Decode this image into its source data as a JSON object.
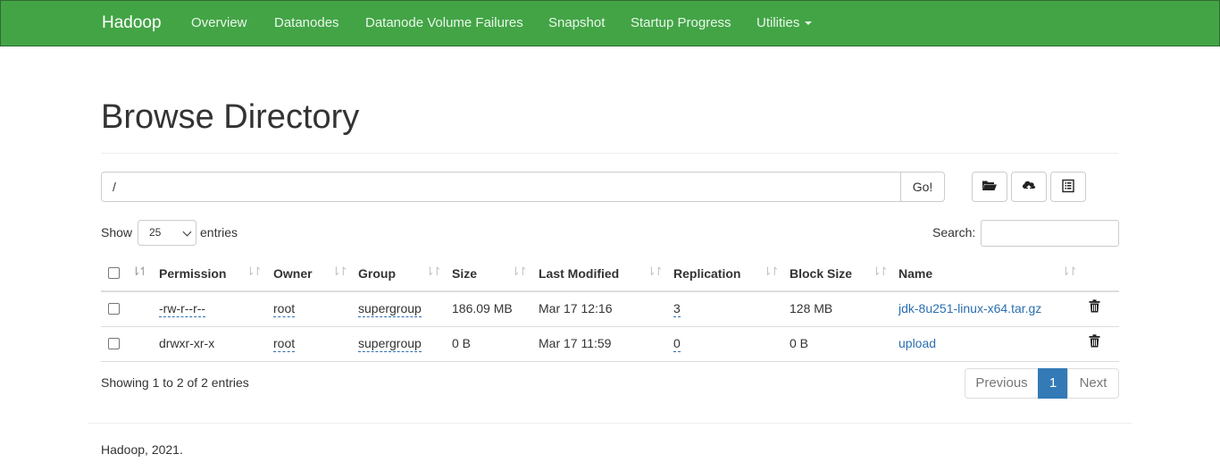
{
  "navbar": {
    "brand": "Hadoop",
    "items": [
      "Overview",
      "Datanodes",
      "Datanode Volume Failures",
      "Snapshot",
      "Startup Progress",
      "Utilities"
    ]
  },
  "page_title": "Browse Directory",
  "path_bar": {
    "value": "/",
    "go_label": "Go!",
    "icons": [
      "folder-open-icon",
      "cloud-upload-icon",
      "list-alt-icon"
    ]
  },
  "table_controls": {
    "show_label": "Show",
    "entries_value": "25",
    "entries_label": "entries",
    "search_label": "Search:"
  },
  "table": {
    "columns": [
      "Permission",
      "Owner",
      "Group",
      "Size",
      "Last Modified",
      "Replication",
      "Block Size",
      "Name"
    ],
    "rows": [
      {
        "permission": "-rw-r--r--",
        "owner": "root",
        "group": "supergroup",
        "size": "186.09 MB",
        "last_modified": "Mar 17 12:16",
        "replication": "3",
        "block_size": "128 MB",
        "name": "jdk-8u251-linux-x64.tar.gz"
      },
      {
        "permission": "drwxr-xr-x",
        "owner": "root",
        "group": "supergroup",
        "size": "0 B",
        "last_modified": "Mar 17 11:59",
        "replication": "0",
        "block_size": "0 B",
        "name": "upload"
      }
    ]
  },
  "info": "Showing 1 to 2 of 2 entries",
  "pagination": {
    "previous": "Previous",
    "current": "1",
    "next": "Next"
  },
  "footer": "Hadoop, 2021.",
  "colors": {
    "navbar_bg": "#43a446",
    "link": "#2a6fb0",
    "active_page": "#337ab7"
  }
}
